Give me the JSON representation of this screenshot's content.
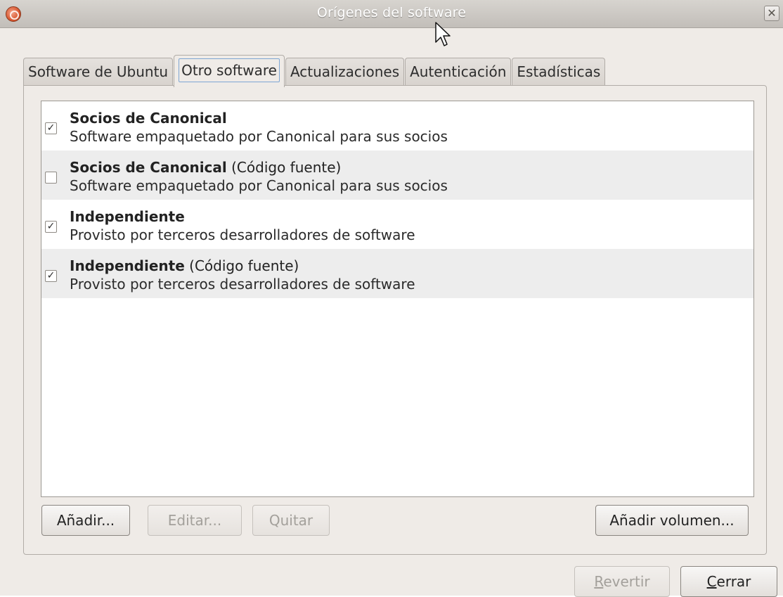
{
  "window": {
    "title": "Orígenes del software",
    "close_glyph": "✕"
  },
  "tabs": [
    {
      "label": "Software de Ubuntu",
      "active": false
    },
    {
      "label": "Otro software",
      "active": true
    },
    {
      "label": "Actualizaciones",
      "active": false
    },
    {
      "label": "Autenticación",
      "active": false
    },
    {
      "label": "Estadísticas",
      "active": false
    }
  ],
  "sources": [
    {
      "name": "Socios de Canonical",
      "suffix": "",
      "description": "Software empaquetado por Canonical para sus socios",
      "checked": true
    },
    {
      "name": "Socios de Canonical",
      "suffix": " (Código fuente)",
      "description": "Software empaquetado por Canonical para sus socios",
      "checked": false
    },
    {
      "name": "Independiente",
      "suffix": "",
      "description": "Provisto por terceros desarrolladores de software",
      "checked": true
    },
    {
      "name": "Independiente",
      "suffix": " (Código fuente)",
      "description": "Provisto por terceros desarrolladores de software",
      "checked": true
    }
  ],
  "buttons": {
    "add": "Añadir...",
    "edit": "Editar...",
    "remove": "Quitar",
    "add_volume": "Añadir volumen...",
    "revert_mnemonic": "R",
    "revert_rest": "evertir",
    "close_mnemonic": "C",
    "close_rest": "errar"
  },
  "check_glyph": "✓"
}
